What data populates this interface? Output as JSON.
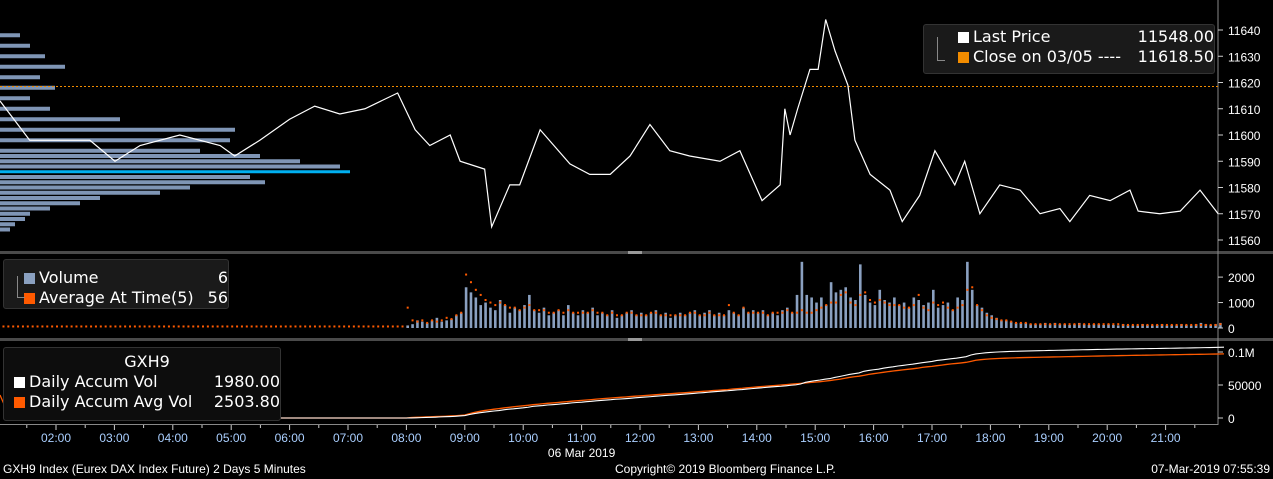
{
  "price_legend": {
    "last_price_label": "Last Price",
    "last_price_value": "11548.00",
    "close_label": "Close on 03/05 ----",
    "close_value": "11618.50"
  },
  "volume_legend": {
    "volume_label": "Volume",
    "volume_value": "6",
    "avg_label": "Average At Time(5)",
    "avg_value": "56"
  },
  "accum_legend": {
    "title": "GXH9",
    "daily_label": "Daily Accum Vol",
    "daily_value": "1980.00",
    "avg_label": "Daily Accum Avg Vol",
    "avg_value": "2503.80"
  },
  "footer": {
    "left": "GXH9 Index (Eurex DAX Index Future) 2 Days 5 Minutes",
    "center": "Copyright© 2019 Bloomberg Finance L.P.",
    "right": "07-Mar-2019 07:55:39"
  },
  "colors": {
    "price": "#ffffff",
    "close": "#f28c00",
    "volume": "#8aa0c0",
    "avg": "#ff5a00",
    "profile": "#7f95b5",
    "profile_poc": "#00b0f0",
    "accum": "#ffffff",
    "accum_avg": "#ff5a00"
  },
  "chart_data": [
    {
      "type": "line",
      "title": "Last Price",
      "xlabel": "06 Mar 2019",
      "x_ticks": [
        "02:00",
        "03:00",
        "04:00",
        "05:00",
        "06:00",
        "07:00",
        "08:00",
        "09:00",
        "10:00",
        "11:00",
        "12:00",
        "13:00",
        "14:00",
        "15:00",
        "16:00",
        "17:00",
        "18:00",
        "19:00",
        "20:00",
        "21:00"
      ],
      "y_ticks": [
        11560,
        11570,
        11580,
        11590,
        11600,
        11610,
        11620,
        11630,
        11640
      ],
      "ylim": [
        11556,
        11652
      ],
      "close_prev": 11618.5,
      "x_hours": [
        1.04,
        1.55,
        2.07,
        2.58,
        3.01,
        3.44,
        4.12,
        4.81,
        5.06,
        5.49,
        6.0,
        6.43,
        6.86,
        7.29,
        7.85,
        8.15,
        8.4,
        8.75,
        8.92,
        9.34,
        9.46,
        9.77,
        9.94,
        10.29,
        10.8,
        11.14,
        11.49,
        11.83,
        12.17,
        12.51,
        12.85,
        13.37,
        13.71,
        14.09,
        14.4,
        14.48,
        14.57,
        14.7,
        14.91,
        15.05,
        15.18,
        15.34,
        15.56,
        15.68,
        15.94,
        16.28,
        16.49,
        16.79,
        17.05,
        17.39,
        17.56,
        17.82,
        18.16,
        18.51,
        18.85,
        19.19,
        19.36,
        19.7,
        20.05,
        20.39,
        20.53,
        20.9,
        21.25,
        21.59,
        21.9
      ],
      "price": [
        11613,
        11598,
        11598,
        11598,
        11590,
        11596,
        11600,
        11596,
        11592,
        11598,
        11606,
        11611,
        11608,
        11610,
        11616,
        11602,
        11596,
        11600,
        11590,
        11587,
        11565,
        11581,
        11581,
        11602,
        11589,
        11585,
        11585,
        11592,
        11604,
        11594,
        11592,
        11590,
        11594,
        11575,
        11581,
        11610,
        11600,
        11610,
        11625,
        11625,
        11644,
        11632,
        11619,
        11598,
        11585,
        11579,
        11567,
        11577,
        11594,
        11581,
        11590,
        11570,
        11581,
        11579,
        11570,
        11572,
        11567,
        11577,
        11575,
        11579,
        11571,
        11570,
        11571,
        11579,
        11570
      ],
      "volume_profile": [
        {
          "price": 11638,
          "vol": 20
        },
        {
          "price": 11634,
          "vol": 30
        },
        {
          "price": 11630,
          "vol": 45
        },
        {
          "price": 11626,
          "vol": 65
        },
        {
          "price": 11622,
          "vol": 40
        },
        {
          "price": 11618,
          "vol": 55
        },
        {
          "price": 11614,
          "vol": 30
        },
        {
          "price": 11610,
          "vol": 50
        },
        {
          "price": 11606,
          "vol": 120
        },
        {
          "price": 11602,
          "vol": 235
        },
        {
          "price": 11598,
          "vol": 230
        },
        {
          "price": 11594,
          "vol": 200
        },
        {
          "price": 11592,
          "vol": 260
        },
        {
          "price": 11590,
          "vol": 300
        },
        {
          "price": 11588,
          "vol": 340
        },
        {
          "price": 11586,
          "vol": 350,
          "poc": true
        },
        {
          "price": 11584,
          "vol": 250
        },
        {
          "price": 11582,
          "vol": 265
        },
        {
          "price": 11580,
          "vol": 190
        },
        {
          "price": 11578,
          "vol": 160
        },
        {
          "price": 11576,
          "vol": 100
        },
        {
          "price": 11574,
          "vol": 80
        },
        {
          "price": 11572,
          "vol": 50
        },
        {
          "price": 11570,
          "vol": 30
        },
        {
          "price": 11568,
          "vol": 25
        },
        {
          "price": 11566,
          "vol": 15
        },
        {
          "price": 11564,
          "vol": 10
        }
      ]
    },
    {
      "type": "bar",
      "title": "Volume / Average At Time(5)",
      "y_ticks": [
        0,
        1000,
        2000
      ],
      "ylim": [
        0,
        2700
      ],
      "start_hour": 8,
      "interval_min": 5,
      "early_volume": 30,
      "early_avg": 60,
      "early_start_hour": 1.0,
      "volume": [
        100,
        150,
        300,
        250,
        200,
        300,
        400,
        250,
        300,
        350,
        500,
        600,
        1600,
        1400,
        1200,
        900,
        1000,
        800,
        700,
        1100,
        900,
        600,
        800,
        700,
        900,
        1300,
        700,
        600,
        800,
        500,
        600,
        700,
        500,
        900,
        600,
        500,
        700,
        600,
        800,
        500,
        600,
        500,
        700,
        400,
        500,
        600,
        700,
        500,
        600,
        500,
        600,
        700,
        500,
        600,
        400,
        500,
        600,
        500,
        600,
        700,
        500,
        600,
        700,
        500,
        600,
        500,
        700,
        600,
        500,
        800,
        600,
        700,
        600,
        700,
        500,
        600,
        500,
        700,
        800,
        600,
        1300,
        2600,
        1300,
        1200,
        1000,
        1200,
        900,
        1800,
        1400,
        1500,
        1600,
        1200,
        1100,
        2500,
        1300,
        1000,
        900,
        1500,
        1100,
        1000,
        1200,
        900,
        1000,
        800,
        1200,
        1100,
        900,
        1000,
        1500,
        800,
        900,
        1000,
        700,
        1200,
        1100,
        2600,
        1500,
        900,
        800,
        600,
        500,
        400,
        300,
        300,
        250,
        200,
        200,
        200,
        150,
        150,
        150,
        200,
        150,
        200,
        150,
        150,
        120,
        150,
        200,
        150,
        120,
        150,
        150,
        120,
        150,
        120,
        100,
        150,
        120,
        100,
        100,
        150,
        120,
        100,
        120,
        150,
        100,
        120,
        100,
        150,
        120,
        100,
        150,
        200,
        150,
        120,
        150,
        200
      ],
      "average": [
        800,
        300,
        250,
        300,
        200,
        300,
        250,
        300,
        400,
        350,
        500,
        600,
        2100,
        1800,
        1500,
        1300,
        1100,
        1000,
        900,
        1000,
        900,
        800,
        800,
        700,
        800,
        900,
        700,
        700,
        700,
        600,
        600,
        700,
        600,
        700,
        600,
        600,
        600,
        600,
        700,
        600,
        600,
        500,
        600,
        500,
        500,
        600,
        600,
        500,
        500,
        500,
        600,
        600,
        500,
        500,
        500,
        500,
        500,
        500,
        600,
        600,
        500,
        500,
        600,
        500,
        500,
        500,
        900,
        600,
        500,
        800,
        600,
        600,
        600,
        600,
        500,
        600,
        600,
        600,
        700,
        600,
        600,
        700,
        600,
        600,
        700,
        800,
        900,
        1000,
        1000,
        1300,
        1400,
        1000,
        900,
        1300,
        1400,
        1100,
        1000,
        1100,
        1000,
        900,
        900,
        900,
        800,
        800,
        900,
        1300,
        800,
        700,
        1000,
        900,
        1000,
        800,
        700,
        800,
        900,
        1500,
        1600,
        900,
        700,
        500,
        400,
        350,
        300,
        300,
        250,
        200,
        200,
        200,
        150,
        150,
        150,
        150,
        150,
        150,
        150,
        150,
        150,
        150,
        150,
        150,
        150,
        150,
        150,
        150,
        150,
        150,
        150,
        120,
        120,
        120,
        120,
        120,
        120,
        120,
        120,
        120,
        120,
        120,
        120,
        120,
        120,
        120,
        120,
        120,
        120,
        120,
        120,
        150
      ]
    },
    {
      "type": "line",
      "title": "Daily Accum Vol",
      "y_ticks": [
        {
          "v": 0,
          "label": "0"
        },
        {
          "v": 50000,
          "label": "50000"
        },
        {
          "v": 100000,
          "label": "0.1M"
        }
      ],
      "ylim": [
        0,
        110000
      ]
    }
  ]
}
